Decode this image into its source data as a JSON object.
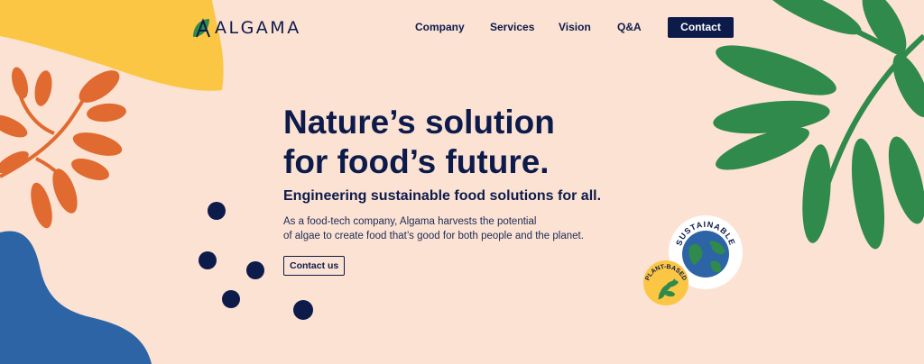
{
  "brand": {
    "name": "ALGAMA",
    "logo_icon": "leaf-a-icon"
  },
  "nav": {
    "items": [
      {
        "label": "Company"
      },
      {
        "label": "Services"
      },
      {
        "label": "Vision"
      },
      {
        "label": "Q&A"
      }
    ],
    "contact_label": "Contact"
  },
  "hero": {
    "title_line1": "Nature’s solution",
    "title_line2": "for food’s future.",
    "subtitle": "Engineering sustainable food solutions for all.",
    "body_line1": "As a food-tech company, Algama harvests the potential",
    "body_line2": "of algae to create food that’s good for both people and the planet.",
    "cta_label": "Contact us"
  },
  "badges": {
    "sustainable": "SUSTAINABLE",
    "plant_based": "PLANT-BASED"
  },
  "colors": {
    "background": "#fbe2d3",
    "navy": "#0d1b4b",
    "yellow": "#fcc645",
    "orange": "#e06a2f",
    "green": "#2f8a4c",
    "blue": "#2c64a6"
  }
}
